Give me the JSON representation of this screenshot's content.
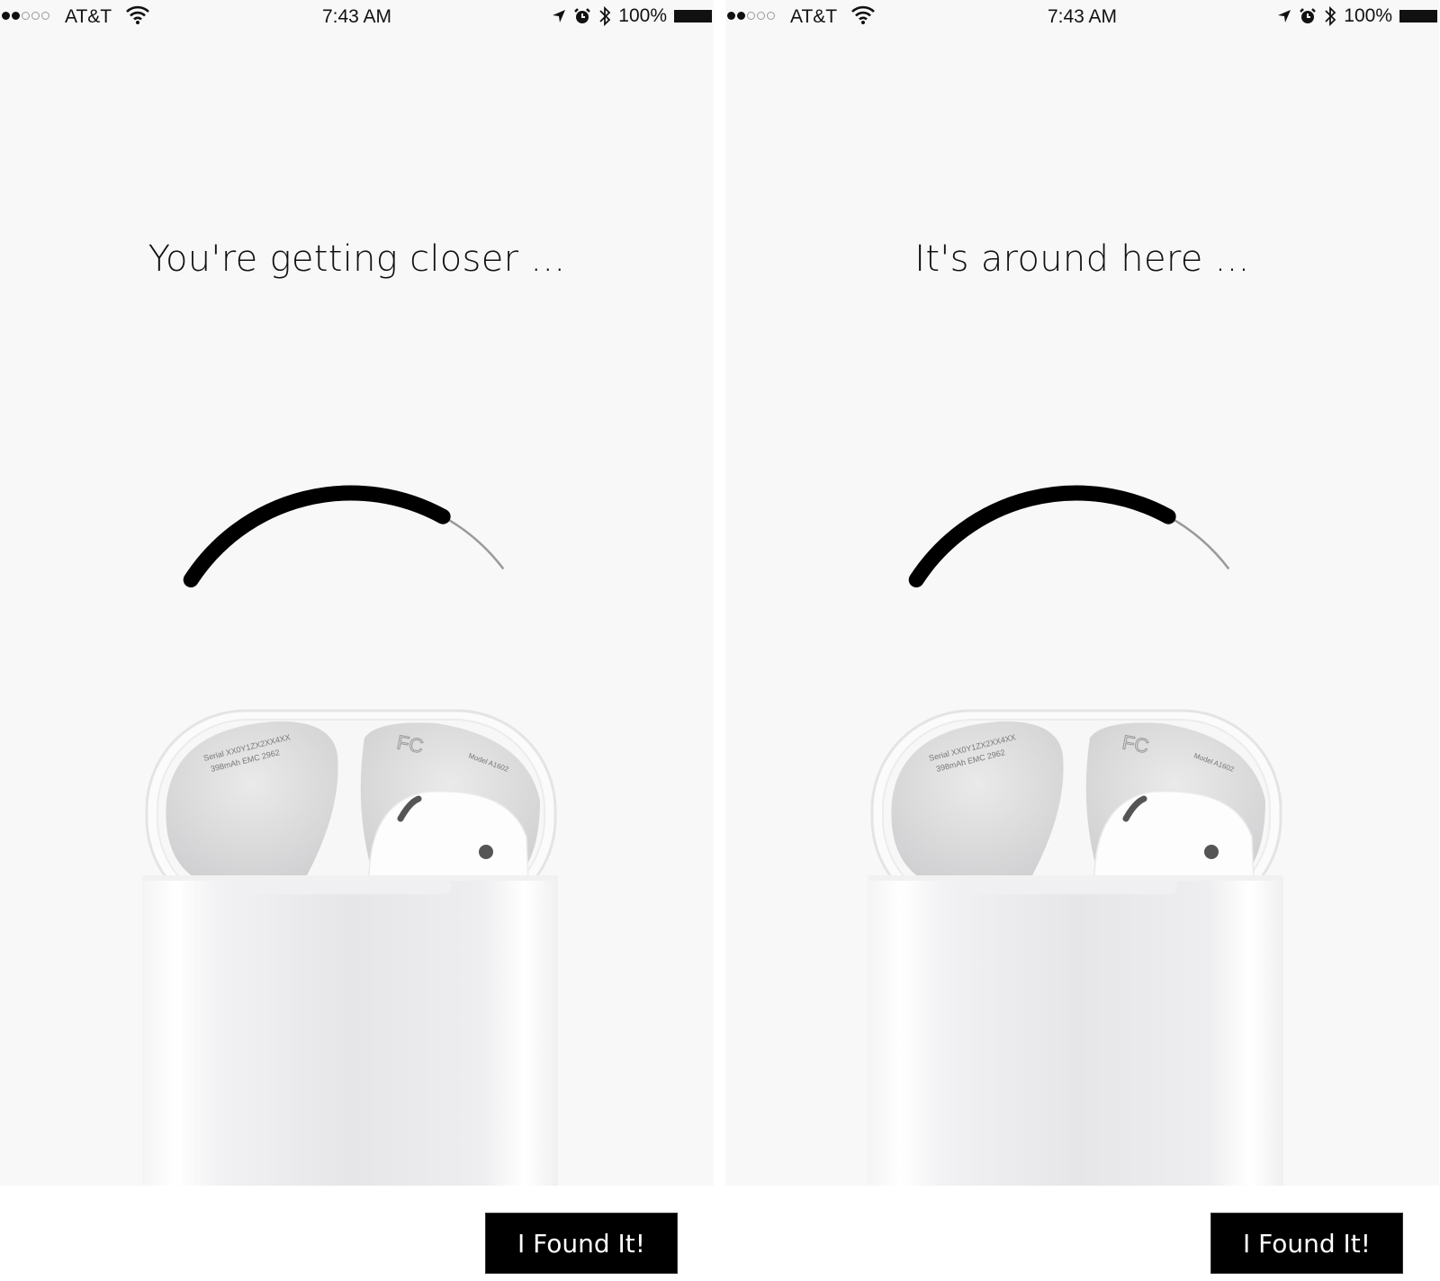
{
  "screens": [
    {
      "status_bar": {
        "signal_bars_filled": 2,
        "signal_bars_total": 5,
        "carrier": "AT&T",
        "wifi_icon": "wifi-icon",
        "time": "7:43 AM",
        "location_icon": "location-arrow-icon",
        "alarm_icon": "alarm-clock-icon",
        "bluetooth_icon": "bluetooth-icon",
        "battery_percent": "100%",
        "battery_icon": "battery-full-icon"
      },
      "message": "You're getting closer ...",
      "proximity": {
        "filled_fraction": 0.78
      },
      "product_image": "airpods-charging-case-open",
      "case_engraving": {
        "serial": "Serial XX0Y1ZX2XX4XX",
        "capacity": "398mAh EMC 2962",
        "model": "Model A1602"
      },
      "button_label": "I Found It!"
    },
    {
      "status_bar": {
        "signal_bars_filled": 2,
        "signal_bars_total": 5,
        "carrier": "AT&T",
        "wifi_icon": "wifi-icon",
        "time": "7:43 AM",
        "location_icon": "location-arrow-icon",
        "alarm_icon": "alarm-clock-icon",
        "bluetooth_icon": "bluetooth-icon",
        "battery_percent": "100%",
        "battery_icon": "battery-full-icon"
      },
      "message": "It's around here ...",
      "proximity": {
        "filled_fraction": 0.78
      },
      "product_image": "airpods-charging-case-open",
      "case_engraving": {
        "serial": "Serial XX0Y1ZX2XX4XX",
        "capacity": "398mAh EMC 2962",
        "model": "Model A1602"
      },
      "button_label": "I Found It!"
    }
  ],
  "colors": {
    "background": "#f8f8f8",
    "arc_filled": "#000000",
    "arc_remaining": "#9a9a9a",
    "button_bg": "#000000",
    "button_text": "#ffffff"
  }
}
